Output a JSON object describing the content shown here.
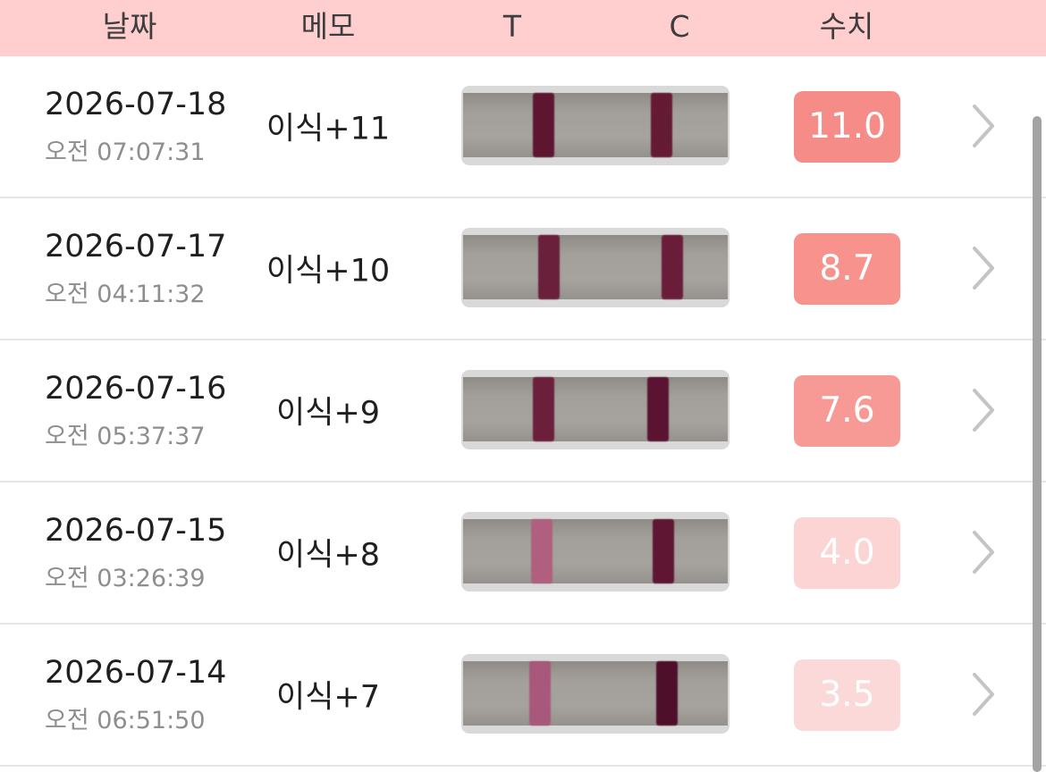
{
  "header": {
    "date_label": "날짜",
    "memo_label": "메모",
    "t_label": "T",
    "c_label": "C",
    "value_label": "수치",
    "background_color": "#fecfce"
  },
  "rows": [
    {
      "date": "2026-07-18",
      "time": "오전 07:07:31",
      "memo": "이식+11",
      "value": "11.0",
      "badge_color": "#f58c87",
      "t_line_color": "#5e1630",
      "c_line_color": "#641a33",
      "chevron_icon": "chevron-right-icon"
    },
    {
      "date": "2026-07-17",
      "time": "오전 04:11:32",
      "memo": "이식+10",
      "value": "8.7",
      "badge_color": "#f7928c",
      "t_line_color": "#6a1f3a",
      "c_line_color": "#6a1d38",
      "chevron_icon": "chevron-right-icon"
    },
    {
      "date": "2026-07-16",
      "time": "오전 05:37:37",
      "memo": "이식+9",
      "value": "7.6",
      "badge_color": "#f79a95",
      "t_line_color": "#6b1f3a",
      "c_line_color": "#5a1330",
      "chevron_icon": "chevron-right-icon"
    },
    {
      "date": "2026-07-15",
      "time": "오전 03:26:39",
      "memo": "이식+8",
      "value": "4.0",
      "badge_color": "#fbd4d3",
      "t_line_color": "#b0607e",
      "c_line_color": "#5e1632",
      "chevron_icon": "chevron-right-icon"
    },
    {
      "date": "2026-07-14",
      "time": "오전 06:51:50",
      "memo": "이식+7",
      "value": "3.5",
      "badge_color": "#fcd9d9",
      "t_line_color": "#a8587a",
      "c_line_color": "#4e0f2a",
      "chevron_icon": "chevron-right-icon"
    }
  ]
}
